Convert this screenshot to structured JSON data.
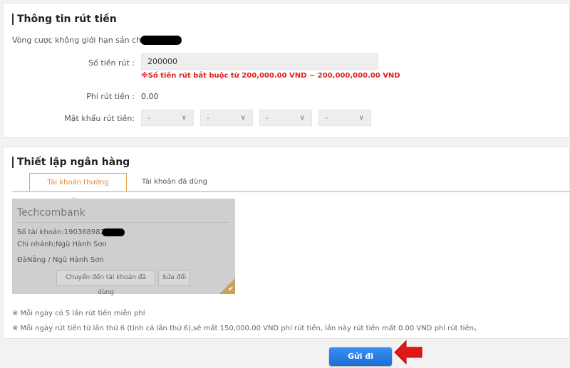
{
  "withdraw": {
    "title": "Thông tin rút tiền",
    "wager_label": "Vòng cược không giới hạn sản chơi :",
    "amount_label": "Số tiền rút :",
    "amount_value": "200000",
    "amount_hint": "※Số tiền rút bắt buộc từ 200,000.00 VND ~ 200,000,000.00 VND",
    "fee_label": "Phí rút tiền :",
    "fee_value": "0.00",
    "password_label": "Mật khẩu rút tiền:",
    "password_selects": [
      "-",
      "-",
      "-",
      "-"
    ]
  },
  "bank": {
    "title": "Thiết lập ngân hàng",
    "tabs": [
      {
        "label": "Tài khoản thường dùng",
        "active": true
      },
      {
        "label": "Tài khoản đã dùng",
        "active": false
      }
    ],
    "card": {
      "bank_name": "Techcombank",
      "account": "Số tài khoản:190368982",
      "branch": "Chi nhánh:Ngũ Hành Sơn",
      "location": "ĐàNẵng / Ngũ Hành Sơn",
      "move_button": "Chuyển đến tài khoản đã dùng",
      "edit_button": "Sửa đổi"
    },
    "notes": [
      "※ Mỗi ngày có 5 lần rút tiền miễn phí",
      "※ Mỗi ngày rút tiền từ lần thứ 6 (tính cả lần thứ 6),sẽ mất 150,000.00 VND phí rút tiền, lần này rút tiền mất 0.00 VND phí rút tiền。"
    ]
  },
  "submit_label": "Gửi đi",
  "colors": {
    "accent": "#e8893a",
    "error": "#e02020",
    "primary": "#1a6fd8",
    "arrow": "#e01818"
  }
}
